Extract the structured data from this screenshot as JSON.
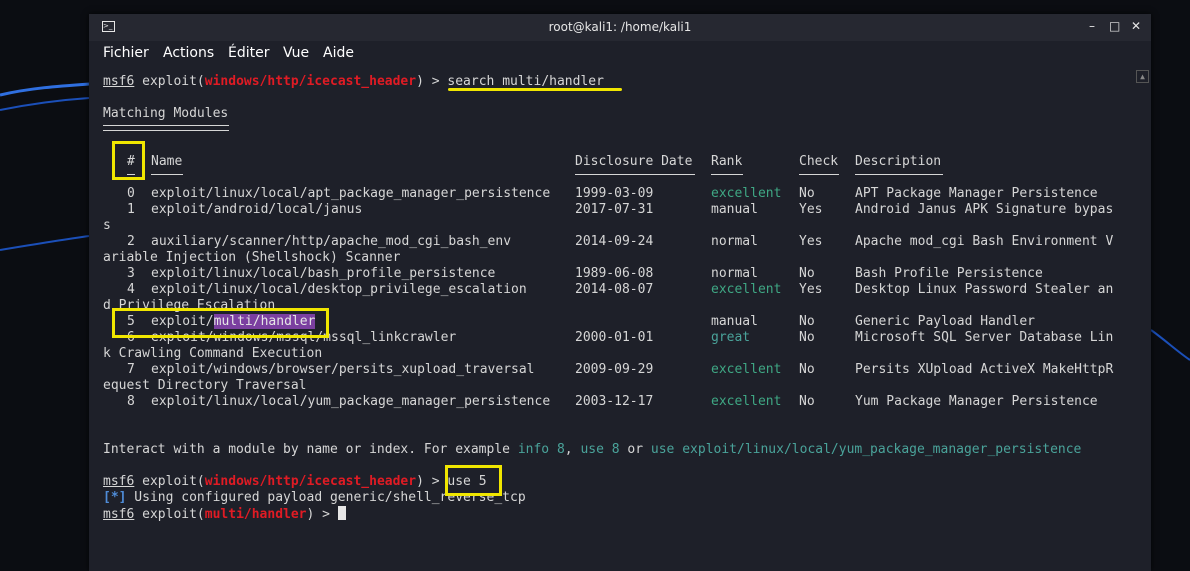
{
  "window": {
    "title": "root@kali1: /home/kali1",
    "minimize": "–",
    "maximize": "□",
    "close": "✕"
  },
  "menu": [
    "Fichier",
    "Actions",
    "Éditer",
    "Vue",
    "Aide"
  ],
  "prompt1": {
    "msf": "msf6",
    "pre": " exploit(",
    "module": "windows/http/icecast_header",
    "post": ") > ",
    "command": "search multi/handler"
  },
  "heading": "Matching Modules",
  "headers": {
    "num": "#",
    "name": "Name",
    "date": "Disclosure Date",
    "rank": "Rank",
    "check": "Check",
    "desc": "Description"
  },
  "rows": [
    {
      "num": "0",
      "name": "exploit/linux/local/apt_package_manager_persistence",
      "date": "1999-03-09",
      "rank": "excellent",
      "check": "No",
      "desc": "APT Package Manager Persistence",
      "wrap": ""
    },
    {
      "num": "1",
      "name": "exploit/android/local/janus",
      "date": "2017-07-31",
      "rank": "manual",
      "check": "Yes",
      "desc": "Android Janus APK Signature bypas",
      "wrap": "s"
    },
    {
      "num": "2",
      "name": "auxiliary/scanner/http/apache_mod_cgi_bash_env",
      "date": "2014-09-24",
      "rank": "normal",
      "check": "Yes",
      "desc": "Apache mod_cgi Bash Environment V",
      "wrap": "ariable Injection (Shellshock) Scanner"
    },
    {
      "num": "3",
      "name": "exploit/linux/local/bash_profile_persistence",
      "date": "1989-06-08",
      "rank": "normal",
      "check": "No",
      "desc": "Bash Profile Persistence",
      "wrap": ""
    },
    {
      "num": "4",
      "name": "exploit/linux/local/desktop_privilege_escalation",
      "date": "2014-08-07",
      "rank": "excellent",
      "check": "Yes",
      "desc": "Desktop Linux Password Stealer an",
      "wrap": "d Privilege Escalation"
    },
    {
      "num": "5",
      "name_pre": "exploit/",
      "name_hl": "multi/handler",
      "date": "",
      "rank": "manual",
      "check": "No",
      "desc": "Generic Payload Handler",
      "wrap": ""
    },
    {
      "num": "6",
      "name": "exploit/windows/mssql/mssql_linkcrawler",
      "date": "2000-01-01",
      "rank": "great",
      "check": "No",
      "desc": "Microsoft SQL Server Database Lin",
      "wrap": "k Crawling Command Execution"
    },
    {
      "num": "7",
      "name": "exploit/windows/browser/persits_xupload_traversal",
      "date": "2009-09-29",
      "rank": "excellent",
      "check": "No",
      "desc": "Persits XUpload ActiveX MakeHttpR",
      "wrap": "equest Directory Traversal"
    },
    {
      "num": "8",
      "name": "exploit/linux/local/yum_package_manager_persistence",
      "date": "2003-12-17",
      "rank": "excellent",
      "check": "No",
      "desc": "Yum Package Manager Persistence",
      "wrap": ""
    }
  ],
  "interact": {
    "pre": "Interact with a module by name or index. For example ",
    "ex1": "info 8",
    "sep1": ", ",
    "ex2": "use 8",
    "sep2": " or ",
    "ex3": "use exploit/linux/local/yum_package_manager_persistence"
  },
  "prompt2": {
    "msf": "msf6",
    "pre": " exploit(",
    "module": "windows/http/icecast_header",
    "post": ") > ",
    "command": "use 5"
  },
  "info_line": {
    "tag": "[*]",
    "text": " Using configured payload generic/shell_reverse_tcp"
  },
  "prompt3": {
    "msf": "msf6",
    "pre": " exploit(",
    "module": "multi/handler",
    "post": ") > "
  },
  "colors": {
    "rank_good": "#3fa784",
    "module_red": "#e01b24",
    "highlight": "#f0e600",
    "selection": "#7b3fa0"
  }
}
